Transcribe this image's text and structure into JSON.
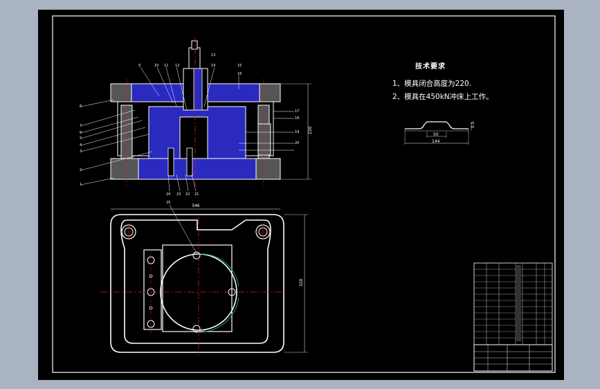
{
  "requirements": {
    "title": "技术要求",
    "items": [
      "1、模具闭合高度为220.",
      "2、模具在450kN冲床上工作。"
    ]
  },
  "dimensions": {
    "section_height": "220",
    "plan_width": "346",
    "plan_height": "320",
    "part_width": "144",
    "part_inner": "50",
    "part_thickness": "0.5"
  },
  "part_numbers": {
    "top": [
      "9",
      "10",
      "11",
      "12",
      "13",
      "14",
      "15"
    ],
    "left": [
      "8",
      "7",
      "6",
      "5",
      "4",
      "3",
      "2",
      "1"
    ],
    "right": [
      "16",
      "17",
      "18",
      "19",
      "20"
    ],
    "bottom": [
      "24",
      "23",
      "22",
      "21"
    ],
    "plan": "25"
  },
  "colors": {
    "background": "#000000",
    "outline": "#ffffff",
    "hatch": "#2a2abf",
    "centerline": "#d02020",
    "green_arc": "#20a060",
    "gray_fill": "#555555"
  }
}
